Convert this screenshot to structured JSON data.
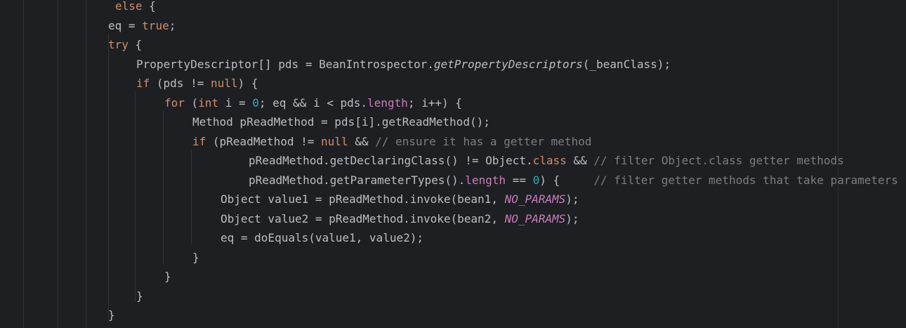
{
  "lines": [
    {
      "indent": 164,
      "tokens": [
        {
          "t": "else",
          "c": "kw"
        },
        {
          "t": " {",
          "c": "plain"
        }
      ]
    },
    {
      "indent": 154,
      "tokens": [
        {
          "t": "eq = ",
          "c": "plain"
        },
        {
          "t": "true",
          "c": "kw"
        },
        {
          "t": ";",
          "c": "plain"
        }
      ]
    },
    {
      "indent": 154,
      "tokens": [
        {
          "t": "try",
          "c": "kw"
        },
        {
          "t": " {",
          "c": "plain"
        }
      ]
    },
    {
      "indent": 194,
      "tokens": [
        {
          "t": "PropertyDescriptor[] pds = BeanIntrospector.",
          "c": "plain"
        },
        {
          "t": "getPropertyDescriptors",
          "c": "mcall"
        },
        {
          "t": "(_beanClass);",
          "c": "plain"
        }
      ]
    },
    {
      "indent": 194,
      "tokens": [
        {
          "t": "if",
          "c": "kw"
        },
        {
          "t": " (pds != ",
          "c": "plain"
        },
        {
          "t": "null",
          "c": "kw"
        },
        {
          "t": ") {",
          "c": "plain"
        }
      ]
    },
    {
      "indent": 234,
      "tokens": [
        {
          "t": "for",
          "c": "kw"
        },
        {
          "t": " (",
          "c": "plain"
        },
        {
          "t": "int",
          "c": "kw"
        },
        {
          "t": " i = ",
          "c": "plain"
        },
        {
          "t": "0",
          "c": "num"
        },
        {
          "t": "; eq && i < pds.",
          "c": "plain"
        },
        {
          "t": "length",
          "c": "field"
        },
        {
          "t": "; i++) {",
          "c": "plain"
        }
      ]
    },
    {
      "indent": 274,
      "tokens": [
        {
          "t": "Method pReadMethod = pds[i].getReadMethod();",
          "c": "plain"
        }
      ]
    },
    {
      "indent": 274,
      "tokens": [
        {
          "t": "if",
          "c": "kw"
        },
        {
          "t": " (pReadMethod != ",
          "c": "plain"
        },
        {
          "t": "null",
          "c": "kw"
        },
        {
          "t": " && ",
          "c": "plain"
        },
        {
          "t": "// ensure it has a getter method",
          "c": "cm"
        }
      ]
    },
    {
      "indent": 354,
      "tokens": [
        {
          "t": "pReadMethod.getDeclaringClass() != Object.",
          "c": "plain"
        },
        {
          "t": "class",
          "c": "kw"
        },
        {
          "t": " && ",
          "c": "plain"
        },
        {
          "t": "// filter Object.class getter methods",
          "c": "cm"
        }
      ]
    },
    {
      "indent": 354,
      "tokens": [
        {
          "t": "pReadMethod.getParameterTypes().",
          "c": "plain"
        },
        {
          "t": "length",
          "c": "field"
        },
        {
          "t": " == ",
          "c": "plain"
        },
        {
          "t": "0",
          "c": "num"
        },
        {
          "t": ") {     ",
          "c": "plain"
        },
        {
          "t": "// filter getter methods that take parameters",
          "c": "cm"
        }
      ]
    },
    {
      "indent": 314,
      "tokens": [
        {
          "t": "Object value1 = pReadMethod.invoke(bean1, ",
          "c": "plain"
        },
        {
          "t": "NO_PARAMS",
          "c": "static"
        },
        {
          "t": ");",
          "c": "plain"
        }
      ]
    },
    {
      "indent": 314,
      "tokens": [
        {
          "t": "Object value2 = pReadMethod.invoke(bean2, ",
          "c": "plain"
        },
        {
          "t": "NO_PARAMS",
          "c": "static"
        },
        {
          "t": ");",
          "c": "plain"
        }
      ]
    },
    {
      "indent": 314,
      "tokens": [
        {
          "t": "eq = doEquals(value1, value2);",
          "c": "plain"
        }
      ]
    },
    {
      "indent": 274,
      "tokens": [
        {
          "t": "}",
          "c": "plain"
        }
      ]
    },
    {
      "indent": 234,
      "tokens": [
        {
          "t": "}",
          "c": "plain"
        }
      ]
    },
    {
      "indent": 194,
      "tokens": [
        {
          "t": "}",
          "c": "plain"
        }
      ]
    },
    {
      "indent": 154,
      "tokens": [
        {
          "t": "}",
          "c": "plain"
        }
      ]
    }
  ]
}
